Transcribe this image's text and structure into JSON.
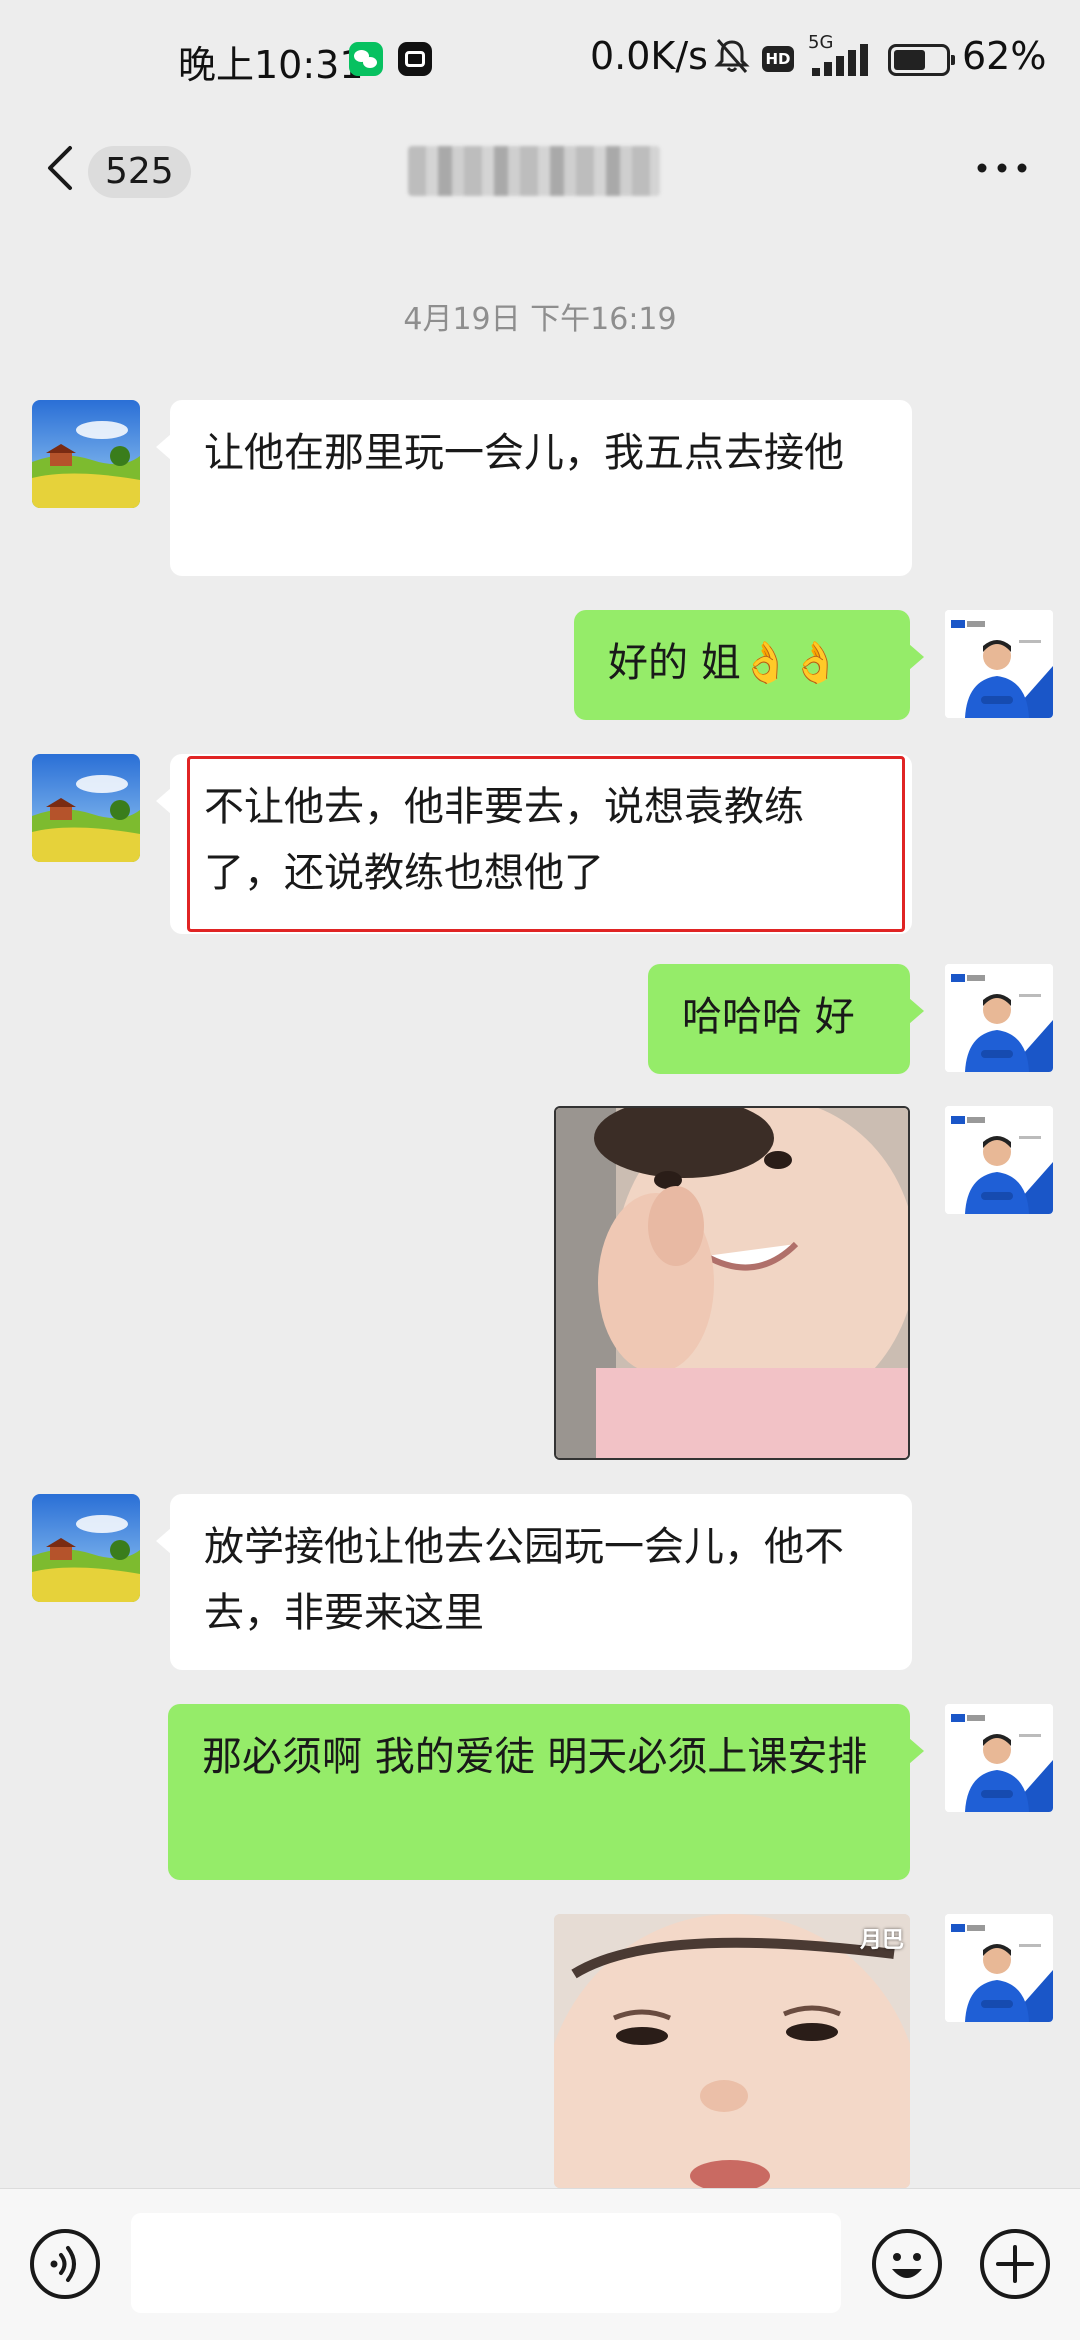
{
  "status_bar": {
    "time": "晚上10:31",
    "net_speed": "0.0K/s",
    "hd_badge": "HD",
    "net_type": "5G",
    "battery_text": "62%",
    "battery_level": 0.62
  },
  "nav": {
    "unread_count": "525",
    "title": ""
  },
  "chat": {
    "timestamp": "4月19日 下午16:19",
    "messages": [
      {
        "side": "in",
        "type": "text",
        "text": "让他在那里玩一会儿，我五点去接他"
      },
      {
        "side": "out",
        "type": "text",
        "text": "好的 姐👌👌"
      },
      {
        "side": "in",
        "type": "text",
        "text": "不让他去，他非要去，说想袁教练了，还说教练也想他了",
        "highlighted": true
      },
      {
        "side": "out",
        "type": "text",
        "text": "哈哈哈 好"
      },
      {
        "side": "out",
        "type": "image",
        "icon": "sticker-child-heart-gesture"
      },
      {
        "side": "in",
        "type": "text",
        "text": "放学接他让他去公园玩一会儿，他不去，非要来这里"
      },
      {
        "side": "out",
        "type": "text",
        "text": "那必须啊 我的爱徒 明天必须上课安排"
      },
      {
        "side": "out",
        "type": "image",
        "icon": "sticker-child-face",
        "badge": "月巴"
      }
    ]
  },
  "input_bar": {
    "value": "",
    "placeholder": ""
  },
  "colors": {
    "background": "#ededed",
    "incoming_bubble": "#ffffff",
    "outgoing_bubble": "#95ec69",
    "highlight_border": "#e02424",
    "brand_avatar_blue": "#1a56c8"
  },
  "icons": {
    "back": "chevron-left-icon",
    "more": "more-dots-icon",
    "voice": "voice-icon",
    "emoji": "emoji-icon",
    "plus": "plus-icon"
  }
}
